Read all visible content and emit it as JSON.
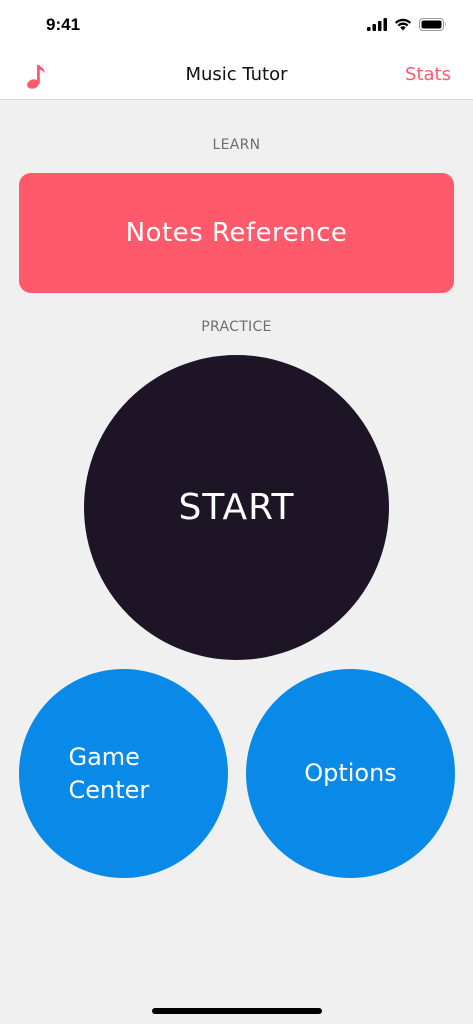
{
  "status_bar": {
    "time": "9:41"
  },
  "nav": {
    "title": "Music Tutor",
    "left_icon": "music-note-icon",
    "right_label": "Stats"
  },
  "learn": {
    "label": "LEARN",
    "notes_button": "Notes Reference"
  },
  "practice": {
    "label": "PRACTICE",
    "start_button": "START"
  },
  "bottom_buttons": {
    "game_center": "Game\nCenter",
    "options": "Options"
  },
  "colors": {
    "accent_red": "#ff5a6b",
    "start_dark": "#1d1426",
    "blue": "#0a8ae8",
    "background": "#f0f0f1"
  }
}
